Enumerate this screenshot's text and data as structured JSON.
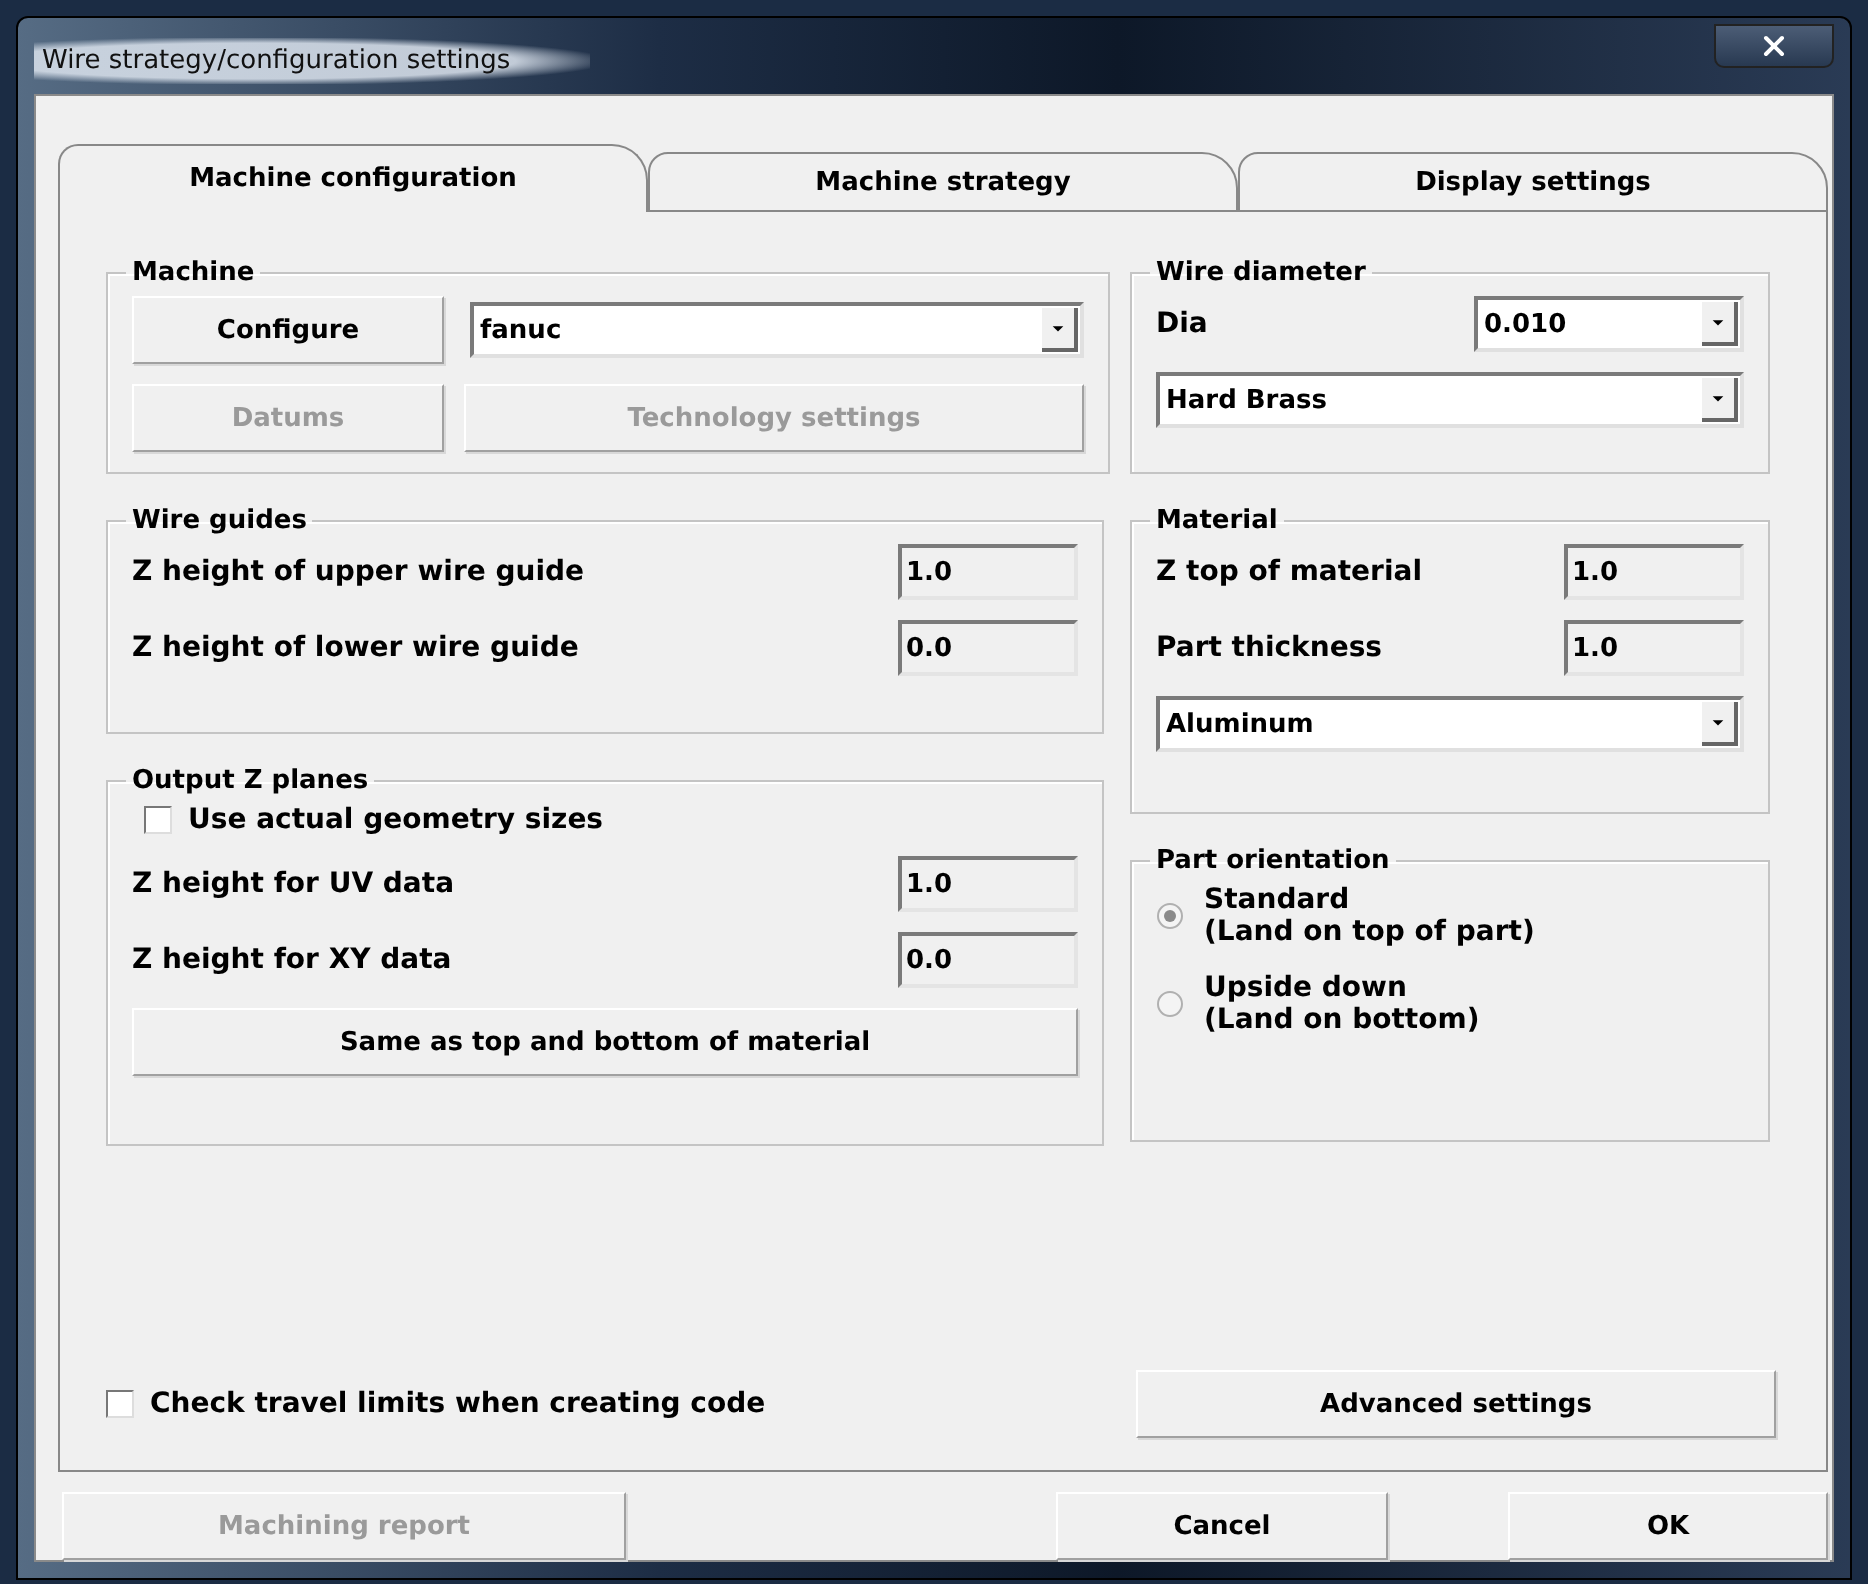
{
  "window": {
    "title": "Wire strategy/configuration settings"
  },
  "tabs": [
    {
      "label": "Machine configuration",
      "selected": true
    },
    {
      "label": "Machine strategy",
      "selected": false
    },
    {
      "label": "Display settings",
      "selected": false
    }
  ],
  "machine": {
    "title": "Machine",
    "configure_button": {
      "label": "Configure",
      "disabled": false
    },
    "machine_dropdown": {
      "value": "fanuc"
    },
    "datums_button": {
      "label": "Datums",
      "disabled": true
    },
    "technology_button": {
      "label": "Technology settings",
      "disabled": true
    }
  },
  "wire_guides": {
    "title": "Wire guides",
    "fields": [
      {
        "label": "Z height of upper wire guide",
        "value": "1.0"
      },
      {
        "label": "Z height of lower wire guide",
        "value": "0.0"
      }
    ]
  },
  "output_z_planes": {
    "title": "Output Z planes",
    "checkbox": {
      "label": "Use actual geometry sizes",
      "checked": false
    },
    "fields": [
      {
        "label": "Z height for UV data",
        "value": "1.0"
      },
      {
        "label": "Z height for XY data",
        "value": "0.0"
      }
    ],
    "button": {
      "label": "Same as top and bottom of material",
      "disabled": false
    }
  },
  "wire_diameter": {
    "title": "Wire diameter",
    "dia_label": "Dia",
    "dia_dropdown": {
      "value": "0.010"
    },
    "wire_dropdown": {
      "value": "Hard Brass"
    }
  },
  "material": {
    "title": "Material",
    "fields": [
      {
        "label": "Z top of material",
        "value": "1.0"
      },
      {
        "label": "Part thickness",
        "value": "1.0"
      }
    ],
    "material_dropdown": {
      "value": "Aluminum"
    }
  },
  "part_orientation": {
    "title": "Part orientation",
    "options": [
      {
        "label": "Standard",
        "sublabel": "(Land on top of part)",
        "selected": true
      },
      {
        "label": "Upside down",
        "sublabel": "(Land on bottom)",
        "selected": false
      }
    ]
  },
  "travel_limits_checkbox": {
    "label": "Check travel limits when creating code",
    "checked": false
  },
  "advanced_button": {
    "label": "Advanced settings",
    "disabled": false
  },
  "footer_buttons": [
    {
      "label": "Machining report",
      "disabled": true
    },
    {
      "label": "Cancel",
      "disabled": false
    },
    {
      "label": "OK",
      "disabled": false
    }
  ]
}
